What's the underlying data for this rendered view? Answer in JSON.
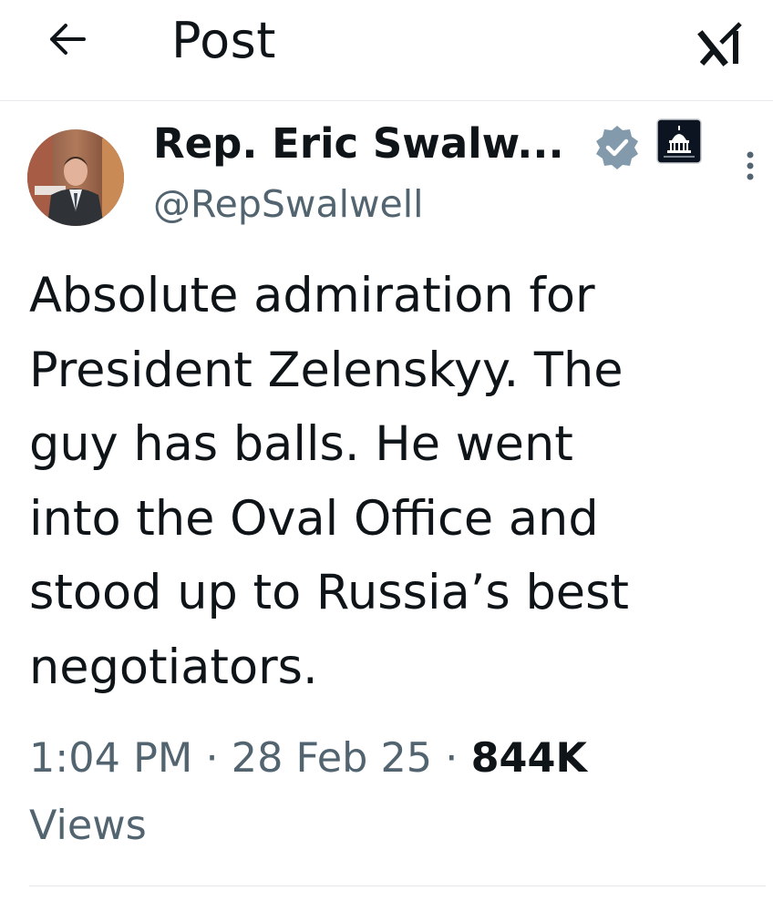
{
  "header": {
    "title": "Post",
    "back_icon": "arrow-left-icon",
    "grok_icon": "grok-icon"
  },
  "author": {
    "display_name": "Rep. Eric Swalw...",
    "handle": "@RepSwalwell",
    "verified_icon": "verified-badge-icon",
    "verified_color": "#829aab",
    "affiliation_icon": "us-house-capitol-icon"
  },
  "post": {
    "text": "Absolute admiration for\nPresident Zelenskyy. The\nguy has balls. He went\ninto the Oval Office and\nstood up to Russia’s best\nnegotiators.",
    "time": "1:04 PM",
    "date": "28 Feb 25",
    "separator": "·",
    "views_count": "844K",
    "views_label": "Views"
  },
  "colors": {
    "text_primary": "#0f1419",
    "text_secondary": "#536471",
    "divider": "#e6e9eb"
  }
}
